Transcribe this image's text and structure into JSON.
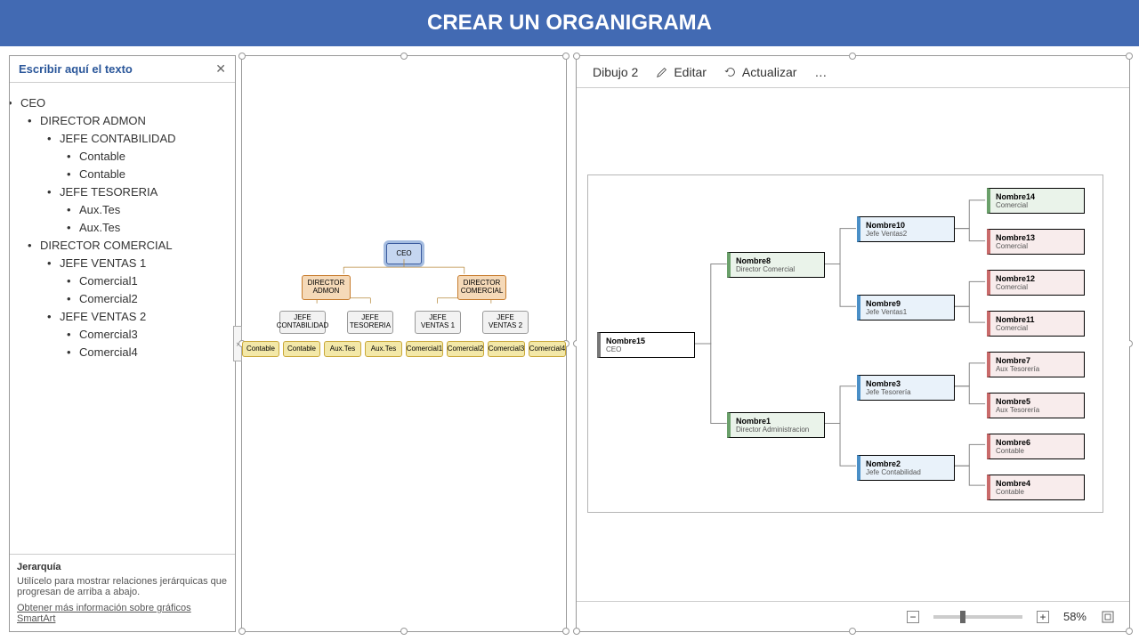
{
  "header": {
    "title": "CREAR UN ORGANIGRAMA"
  },
  "text_panel": {
    "title": "Escribir aquí el texto",
    "close": "✕",
    "outline": {
      "l0": "CEO",
      "l1a": "DIRECTOR ADMON",
      "l2a": "JEFE CONTABILIDAD",
      "l3a": "Contable",
      "l3b": "Contable",
      "l2b": "JEFE TESORERIA",
      "l3c": "Aux.Tes",
      "l3d": "Aux.Tes",
      "l1b": "DIRECTOR COMERCIAL",
      "l2c": "JEFE VENTAS 1",
      "l3e": "Comercial1",
      "l3f": "Comercial2",
      "l2d": "JEFE VENTAS 2",
      "l3g": "Comercial3",
      "l3h": "Comercial4"
    },
    "hint_title": "Jerarquía",
    "hint_body": "Utilícelo para mostrar relaciones jerárquicas que progresan de arriba a abajo.",
    "hint_link": "Obtener más información sobre gráficos SmartArt"
  },
  "canvas": {
    "expander": "›",
    "ceo": "CEO",
    "dir1": "DIRECTOR ADMON",
    "dir2": "DIRECTOR COMERCIAL",
    "j1": "JEFE CONTABILIDAD",
    "j2": "JEFE TESORERIA",
    "j3": "JEFE VENTAS 1",
    "j4": "JEFE VENTAS 2",
    "leaf1": "Contable",
    "leaf2": "Contable",
    "leaf3": "Aux.Tes",
    "leaf4": "Aux.Tes",
    "leaf5": "Comercial1",
    "leaf6": "Comercial2",
    "leaf7": "Comercial3",
    "leaf8": "Comercial4"
  },
  "right": {
    "title": "Dibujo 2",
    "edit": "Editar",
    "refresh": "Actualizar",
    "more": "…",
    "zoom": "58%",
    "cards": {
      "ceo": {
        "nm": "Nombre15",
        "rl": "CEO"
      },
      "dcom": {
        "nm": "Nombre8",
        "rl": "Director Comercial"
      },
      "dadm": {
        "nm": "Nombre1",
        "rl": "Director Administracion"
      },
      "jv2": {
        "nm": "Nombre10",
        "rl": "Jefe Ventas2"
      },
      "jv1": {
        "nm": "Nombre9",
        "rl": "Jefe Ventas1"
      },
      "jt": {
        "nm": "Nombre3",
        "rl": "Jefe Tesorería"
      },
      "jc": {
        "nm": "Nombre2",
        "rl": "Jefe Contabilidad"
      },
      "c14": {
        "nm": "Nombre14",
        "rl": "Comercial"
      },
      "c13": {
        "nm": "Nombre13",
        "rl": "Comercial"
      },
      "c12": {
        "nm": "Nombre12",
        "rl": "Comercial"
      },
      "c11": {
        "nm": "Nombre11",
        "rl": "Comercial"
      },
      "c7": {
        "nm": "Nombre7",
        "rl": "Aux Tesorería"
      },
      "c5": {
        "nm": "Nombre5",
        "rl": "Aux Tesorería"
      },
      "c6": {
        "nm": "Nombre6",
        "rl": "Contable"
      },
      "c4": {
        "nm": "Nombre4",
        "rl": "Contable"
      }
    }
  }
}
